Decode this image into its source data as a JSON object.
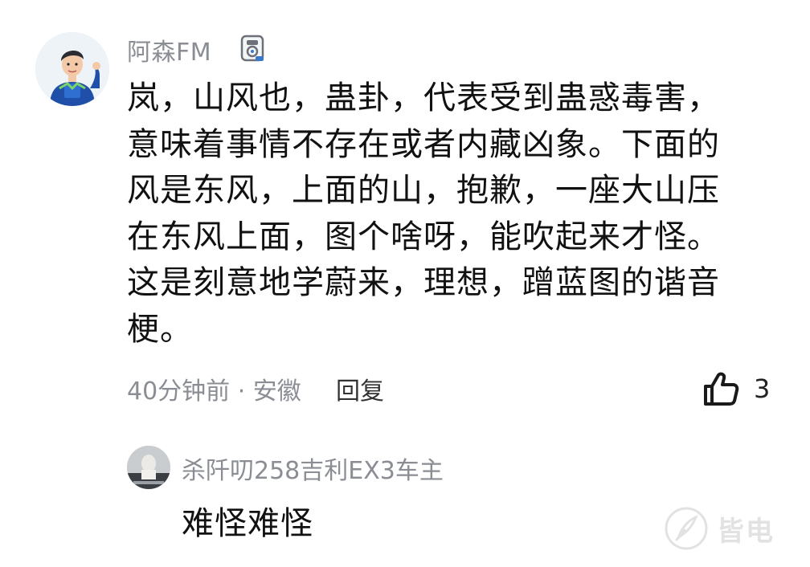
{
  "comment": {
    "username": "阿森FM",
    "badge_icon": "medal-badge-icon",
    "lines": [
      "岚，山风也，蛊卦，代表受到蛊惑毒害，",
      "意味着事情不存在或者内藏凶象。下面的",
      "风是东风，上面的山，抱歉，一座大山压",
      "在东风上面，图个啥呀，能吹起来才怪。",
      "这是刻意地学蔚来，理想，蹭蓝图的谐音",
      "梗。"
    ],
    "meta": "40分钟前 · 安徽",
    "reply_label": "回复",
    "like_icon": "thumbs-up-icon",
    "like_count": "3"
  },
  "reply": {
    "username": "杀阡叨258吉利EX3车主",
    "text": "难怪难怪"
  },
  "watermark": {
    "logo_icon": "feather-logo-icon",
    "text": "皆电"
  }
}
